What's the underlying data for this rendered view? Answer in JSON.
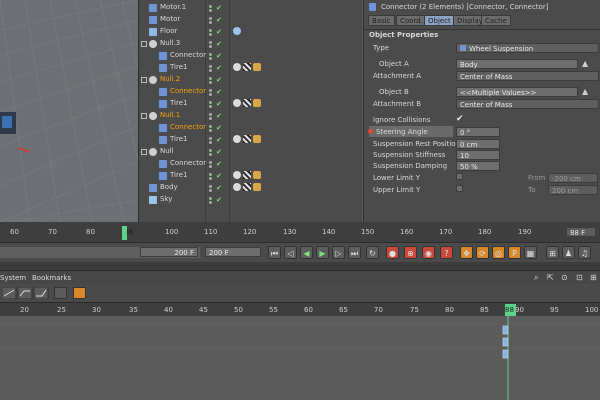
{
  "object_manager": {
    "objects": [
      {
        "name": "Motor.1",
        "indent": 0,
        "icon": "motor-icon",
        "selected": false
      },
      {
        "name": "Motor",
        "indent": 0,
        "icon": "motor-icon",
        "selected": false
      },
      {
        "name": "Floor",
        "indent": 0,
        "icon": "floor-icon",
        "selected": false
      },
      {
        "name": "Null.3",
        "indent": 0,
        "icon": "null-icon",
        "selected": false
      },
      {
        "name": "Connector",
        "indent": 1,
        "icon": "connector-icon",
        "selected": false
      },
      {
        "name": "Tire1",
        "indent": 1,
        "icon": "tire-icon",
        "selected": false
      },
      {
        "name": "Null.2",
        "indent": 0,
        "icon": "null-icon",
        "selected": true
      },
      {
        "name": "Connector",
        "indent": 1,
        "icon": "connector-icon",
        "selected": true
      },
      {
        "name": "Tire1",
        "indent": 1,
        "icon": "tire-icon",
        "selected": false
      },
      {
        "name": "Null.1",
        "indent": 0,
        "icon": "null-icon",
        "selected": true
      },
      {
        "name": "Connector",
        "indent": 1,
        "icon": "connector-icon",
        "selected": true
      },
      {
        "name": "Tire1",
        "indent": 1,
        "icon": "tire-icon",
        "selected": false
      },
      {
        "name": "Null",
        "indent": 0,
        "icon": "null-icon",
        "selected": false
      },
      {
        "name": "Connector",
        "indent": 1,
        "icon": "connector-icon",
        "selected": false
      },
      {
        "name": "Tire1",
        "indent": 1,
        "icon": "tire-icon",
        "selected": false
      },
      {
        "name": "Body",
        "indent": 0,
        "icon": "body-icon",
        "selected": false
      },
      {
        "name": "Sky",
        "indent": 0,
        "icon": "sky-icon",
        "selected": false
      }
    ]
  },
  "attributes": {
    "header": "Connector (2 Elements) [Connector, Connector]",
    "tabs": [
      {
        "label": "Basic",
        "active": false
      },
      {
        "label": "Coord.",
        "active": false
      },
      {
        "label": "Object",
        "active": true
      },
      {
        "label": "Display",
        "active": false
      },
      {
        "label": "Cache",
        "active": false
      }
    ],
    "section_title": "Object Properties",
    "type_label": "Type",
    "type_value": "Wheel Suspension",
    "object_a_label": "Object A",
    "object_a_value": "Body",
    "attachment_a_label": "Attachment A",
    "attachment_a_value": "Center of Mass",
    "object_b_label": "Object B",
    "object_b_value": "<<Multiple Values>>",
    "attachment_b_label": "Attachment B",
    "attachment_b_value": "Center of Mass",
    "ignore_collisions_label": "Ignore Collisions",
    "steering_angle_label": "Steering Angle",
    "steering_angle_value": "0 °",
    "rest_position_label": "Suspension Rest Position",
    "rest_position_value": "0 cm",
    "stiffness_label": "Suspension Stiffness",
    "stiffness_value": "10",
    "damping_label": "Suspension Damping",
    "damping_value": "50 %",
    "lower_limit_label": "Lower Limit Y",
    "upper_limit_label": "Upper Limit Y",
    "from_label": "From",
    "from_value": "-200 cm",
    "to_label": "To",
    "to_value": "200 cm"
  },
  "timeline": {
    "ticks": [
      "60",
      "70",
      "80",
      "88",
      "100",
      "110",
      "120",
      "130",
      "140",
      "150",
      "160",
      "170",
      "180",
      "190"
    ],
    "current_frame": "88",
    "current_frame_field": "88 F",
    "min_field": "200 F",
    "max_field": "200 F"
  },
  "dopesheet": {
    "menu": [
      "System",
      "Bookmarks"
    ],
    "ticks": [
      "20",
      "25",
      "30",
      "35",
      "40",
      "45",
      "50",
      "55",
      "60",
      "65",
      "70",
      "75",
      "80",
      "85",
      "88",
      "90",
      "95",
      "100"
    ],
    "current_frame": "88"
  },
  "colors": {
    "selected_text": "#f1a20f",
    "playhead": "#5dd38a",
    "active_tab": "#8ba4c6"
  }
}
